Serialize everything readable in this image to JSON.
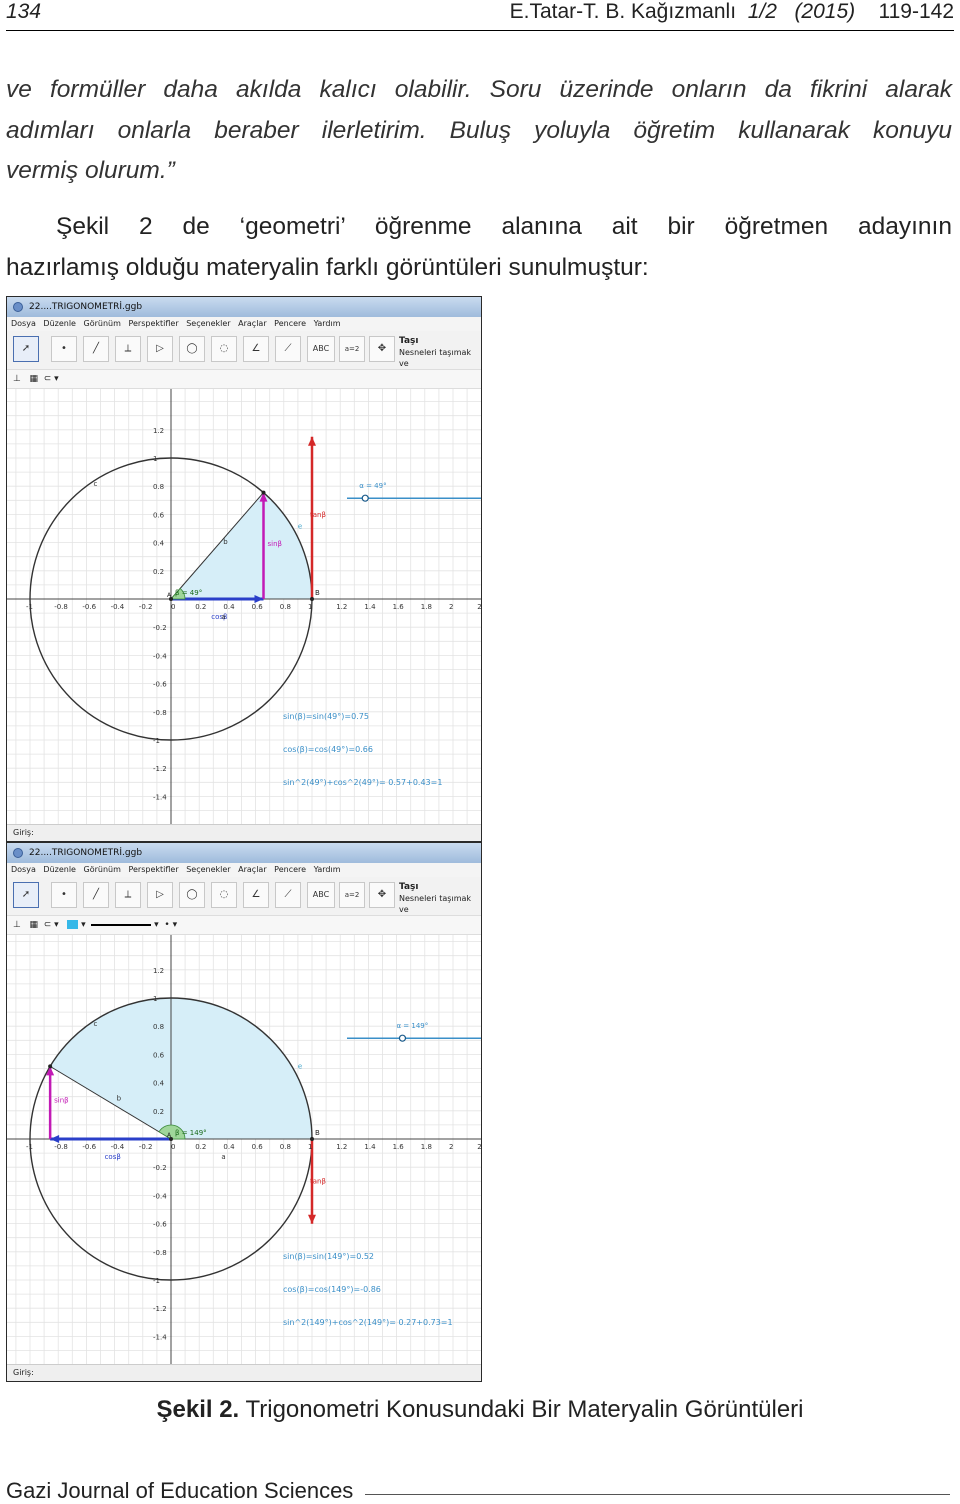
{
  "header": {
    "page_number": "134",
    "authors": "E.Tatar-T. B. Kağızmanlı",
    "issue": "1/2",
    "year": "(2015)",
    "pages": "119-142"
  },
  "quote_lines": [
    "ve formüller daha akılda kalıcı olabilir. Soru üzerinde onların da fikrini alarak",
    "adımları onlarla beraber ilerletirim. Buluş yoluyla öğretim kullanarak konuyu",
    "vermiş olurum.”"
  ],
  "body_lines": [
    "Şekil 2 de ‘geometri’ öğrenme alanına ait bir öğretmen adayının",
    "hazırlamış olduğu materyalin farklı görüntüleri sunulmuştur:"
  ],
  "caption": {
    "label": "Şekil 2.",
    "text": " Trigonometri Konusundaki Bir Materyalin Görüntüleri"
  },
  "footer": {
    "journal": "Gazi Journal of Education Sciences"
  },
  "geogebra": {
    "window_title": "22....TRIGONOMETRİ.ggb",
    "menu": [
      "Dosya",
      "Düzenle",
      "Görünüm",
      "Perspektifler",
      "Seçenekler",
      "Araçlar",
      "Pencere",
      "Yardım"
    ],
    "tool_name": "Taşı",
    "tool_hint": "Nesneleri taşımak ve",
    "input_label": "Giriş:",
    "x_ticks": [
      "-1",
      "-0.8",
      "-0.6",
      "-0.4",
      "-0.2",
      "0",
      "0.2",
      "0.4",
      "0.6",
      "0.8",
      "1",
      "1.2",
      "1.4",
      "1.6",
      "1.8",
      "2",
      "2"
    ],
    "y_ticks": [
      "1.2",
      "1",
      "0.8",
      "0.6",
      "0.4",
      "0.2",
      "-0.2",
      "-0.4",
      "-0.6",
      "-0.8",
      "-1",
      "-1.2",
      "-1.4"
    ],
    "colors": {
      "sin": "#c21ab5",
      "tan": "#d42828",
      "cos": "#2a3fc9",
      "fill": "#d6eef8",
      "text": "#3a8fc8"
    },
    "label_sin": "sinβ",
    "label_cos": "cosβ",
    "label_tan": "tanβ",
    "label_a": "a",
    "label_b": "b",
    "label_c": "c",
    "label_e": "e",
    "label_A": "A",
    "label_B": "B",
    "views": [
      {
        "angle_deg": 49,
        "slider_label": "α = 49°",
        "angle_label": "β = 49°",
        "eq_sin": "sin(β)=sin(49°)=0.75",
        "eq_cos": "cos(β)=cos(49°)=0.66",
        "eq_sum": "sin^2(49°)+cos^2(49°)= 0.57+0.43=1"
      },
      {
        "angle_deg": 149,
        "slider_label": "α = 149°",
        "angle_label": "β = 149°",
        "eq_sin": "sin(β)=sin(149°)=0.52",
        "eq_cos": "cos(β)=cos(149°)=-0.86",
        "eq_sum": "sin^2(149°)+cos^2(149°)= 0.27+0.73=1"
      }
    ]
  }
}
